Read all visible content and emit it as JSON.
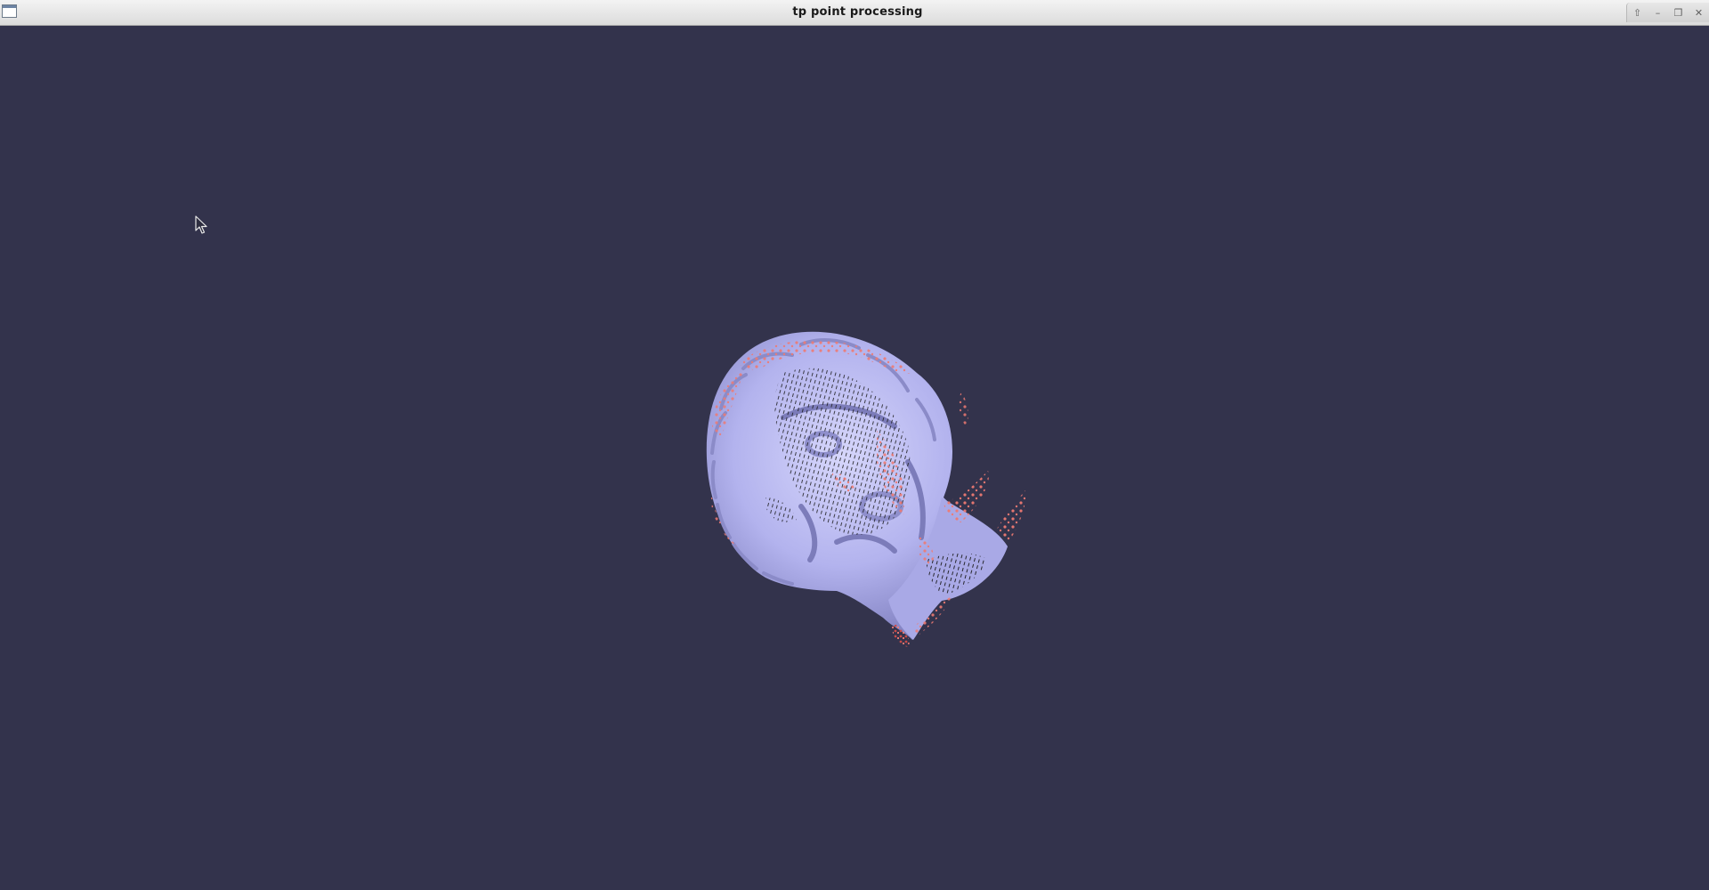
{
  "window": {
    "title": "tp point processing",
    "controls": {
      "shade_symbol": "⇧",
      "minimize_symbol": "–",
      "maximize_symbol": "❐",
      "close_symbol": "✕"
    }
  },
  "viewport": {
    "background": "#33334c",
    "model": {
      "surface_color": "#b3b3ee",
      "highlight_color": "#ee7a72",
      "point_color": "#1a1a1a"
    }
  }
}
